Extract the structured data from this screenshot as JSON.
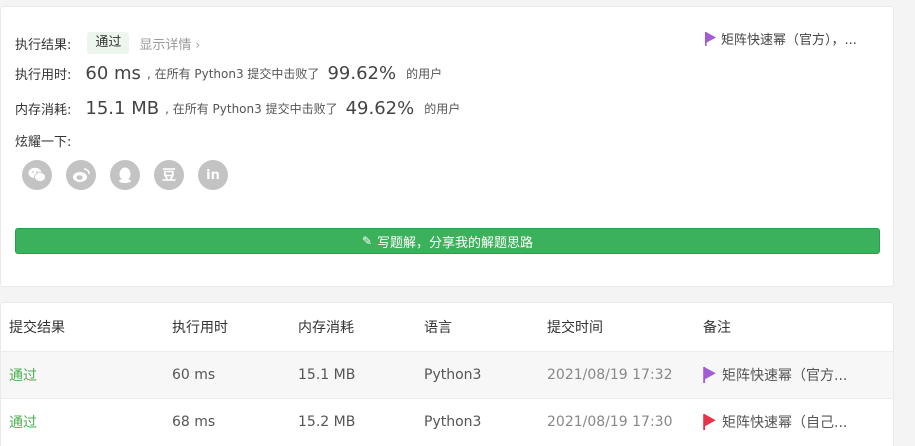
{
  "result": {
    "label": "执行结果:",
    "status": "通过",
    "details": "显示详情",
    "note": "矩阵快速幂（官方），...",
    "note_flag_color": "#a45bd6"
  },
  "runtime": {
    "label": "执行用时:",
    "value": "60 ms",
    "prefix": ", 在所有 Python3 提交中击败了",
    "percent": "99.62%",
    "suffix": "的用户"
  },
  "memory": {
    "label": "内存消耗:",
    "value": "15.1 MB",
    "prefix": ", 在所有 Python3 提交中击败了",
    "percent": "49.62%",
    "suffix": "的用户"
  },
  "share": {
    "label": "炫耀一下:",
    "icons": [
      "wechat-icon",
      "weibo-icon",
      "qq-icon",
      "douban-icon",
      "linkedin-icon"
    ],
    "douban_glyph": "豆",
    "linkedin_glyph": "in"
  },
  "write_button": "写题解，分享我的解题思路",
  "table": {
    "headers": [
      "提交结果",
      "执行用时",
      "内存消耗",
      "语言",
      "提交时间",
      "备注"
    ],
    "rows": [
      {
        "result": "通过",
        "runtime": "60 ms",
        "memory": "15.1 MB",
        "lang": "Python3",
        "time": "2021/08/19 17:32",
        "note": "矩阵快速幂（官方...",
        "flag_color": "#a45bd6"
      },
      {
        "result": "通过",
        "runtime": "68 ms",
        "memory": "15.2 MB",
        "lang": "Python3",
        "time": "2021/08/19 17:30",
        "note": "矩阵快速幂（自己...",
        "flag_color": "#e8334a"
      }
    ]
  },
  "colors": {
    "accent_green": "#3cb15b",
    "pass_green": "#4caf50"
  }
}
